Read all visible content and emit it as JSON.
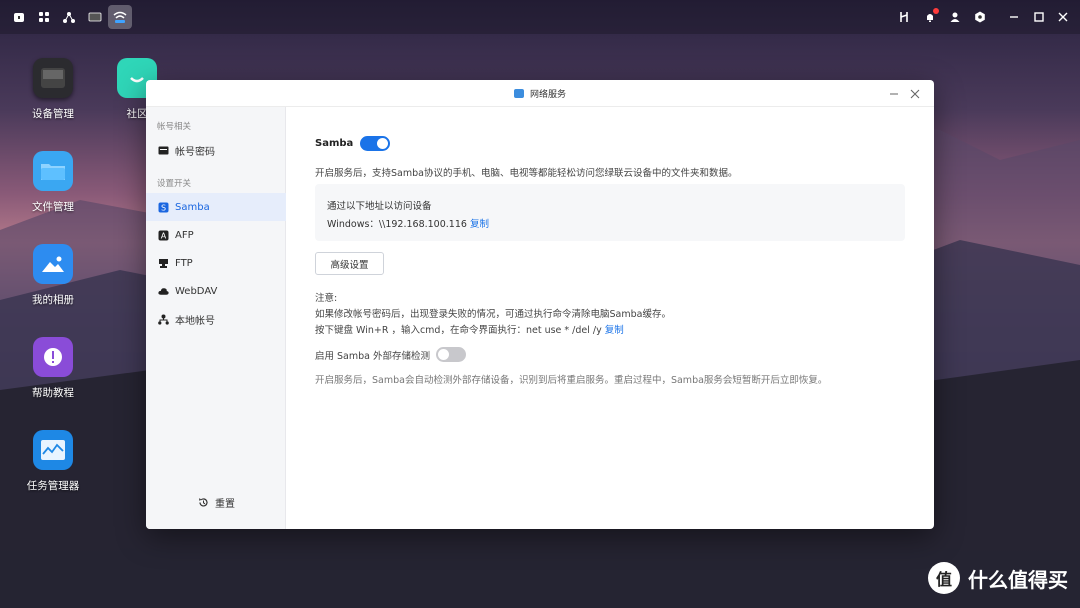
{
  "topbar": {
    "left_icons": [
      "home-icon",
      "apps-grid-icon",
      "network-share-icon",
      "monitor-icon",
      "wifi-network-icon"
    ],
    "right_icons": [
      "tools-icon",
      "bell-icon",
      "user-icon",
      "settings-icon",
      "minimize-icon",
      "maximize-icon",
      "close-icon"
    ],
    "notification_color": "#ff3b3b"
  },
  "desktop": {
    "icons": [
      {
        "label": "设备管理",
        "icon": "device-icon"
      },
      {
        "label": "社区",
        "icon": "community-icon"
      },
      {
        "label": "文件管理",
        "icon": "folder-icon"
      },
      {
        "label": "我的相册",
        "icon": "photo-icon"
      },
      {
        "label": "帮助教程",
        "icon": "help-icon"
      },
      {
        "label": "任务管理器",
        "icon": "task-manager-icon"
      }
    ]
  },
  "window": {
    "title": "网络服务",
    "sidebar": {
      "group1": "帐号相关",
      "account_password": "帐号密码",
      "group2": "设置开关",
      "items": [
        {
          "label": "Samba",
          "active": true
        },
        {
          "label": "AFP",
          "active": false
        },
        {
          "label": "FTP",
          "active": false
        },
        {
          "label": "WebDAV",
          "active": false
        },
        {
          "label": "本地帐号",
          "active": false
        }
      ],
      "reset": "重置"
    },
    "content": {
      "service_name": "Samba",
      "service_enabled": true,
      "service_desc": "开启服务后，支持Samba协议的手机、电脑、电视等都能轻松访问您绿联云设备中的文件夹和数据。",
      "access_title": "通过以下地址以访问设备",
      "windows_prefix": "Windows：",
      "windows_address": "\\\\192.168.100.116",
      "copy_label": "复制",
      "advanced_button": "高级设置",
      "note_title": "注意:",
      "note_line1": "如果修改帐号密码后，出现登录失败的情况，可通过执行命令清除电脑Samba缓存。",
      "note_line2": "按下键盘 Win+R ，输入cmd，在命令界面执行：net use * /del /y",
      "note_copy": "复制",
      "external_label": "启用 Samba 外部存储检测",
      "external_enabled": false,
      "external_desc": "开启服务后，Samba会自动检测外部存储设备，识别到后将重启服务。重启过程中，Samba服务会短暂断开后立即恢复。"
    }
  },
  "watermark": {
    "logo": "值",
    "text": "什么值得买"
  },
  "colors": {
    "accent": "#1a73e8",
    "active_bg": "#e6edfb"
  }
}
